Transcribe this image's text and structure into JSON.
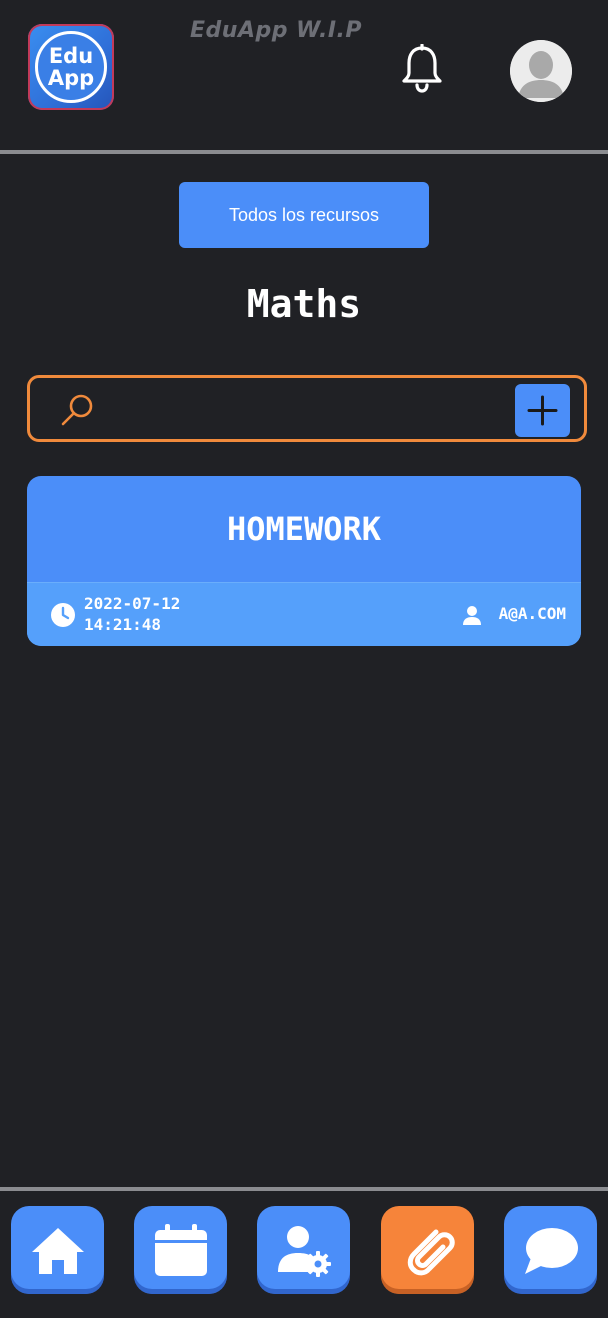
{
  "header": {
    "logo_line1": "Edu",
    "logo_line2": "App",
    "app_title": "EduApp W.I.P",
    "notification_icon": "bell-icon",
    "avatar_icon": "avatar-silhouette-icon"
  },
  "main": {
    "resources_button_label": "Todos los recursos",
    "subject_title": "Maths"
  },
  "search": {
    "value": "",
    "placeholder": "",
    "search_icon": "search-icon",
    "add_icon": "plus-icon"
  },
  "resources": [
    {
      "title": "HOMEWORK",
      "date": "2022-07-12",
      "time": "14:21:48",
      "author": "A@A.COM"
    }
  ],
  "nav": {
    "items": [
      {
        "icon": "home-icon",
        "active": false
      },
      {
        "icon": "calendar-icon",
        "active": false
      },
      {
        "icon": "user-settings-icon",
        "active": false
      },
      {
        "icon": "paperclip-icon",
        "active": true
      },
      {
        "icon": "chat-icon",
        "active": false
      }
    ]
  },
  "colors": {
    "background": "#202125",
    "accent_blue": "#4b8ef9",
    "accent_orange": "#f6843a",
    "search_border": "#f08a3c"
  }
}
